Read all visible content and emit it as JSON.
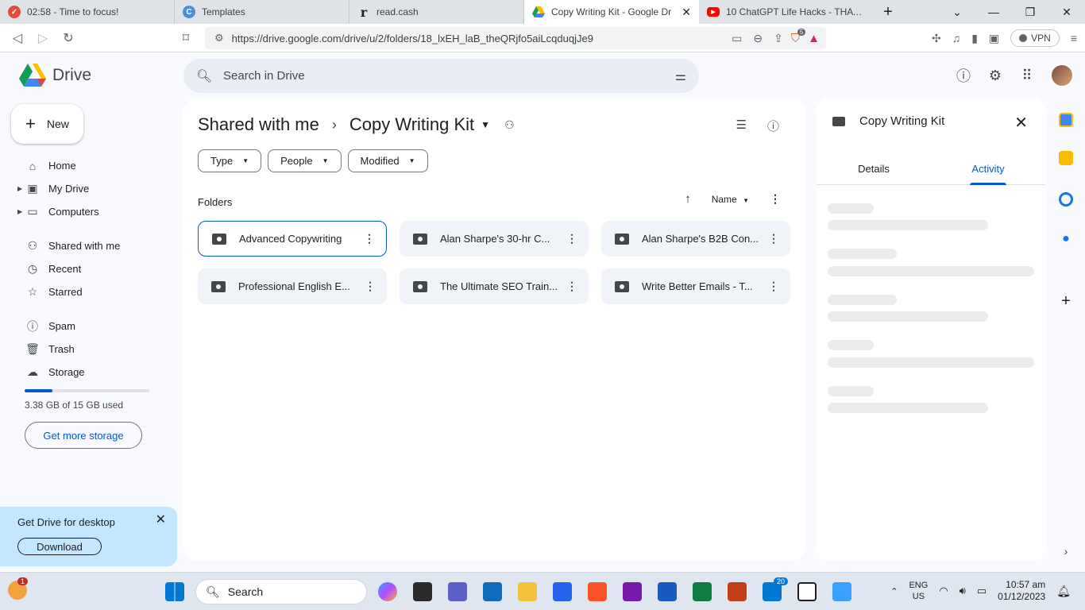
{
  "browser": {
    "tabs": [
      {
        "label": "02:58 - Time to focus!",
        "color": "#e34c3c",
        "icon": "focus-timer-icon"
      },
      {
        "label": "Templates",
        "color": "#4a90d9",
        "icon": "canva-icon"
      },
      {
        "label": "read.cash",
        "color": "#202124",
        "icon": "readcash-icon"
      },
      {
        "label": "Copy Writing Kit - Google Dr",
        "color": "#fbbc04",
        "icon": "drive-icon"
      },
      {
        "label": "10 ChatGPT Life Hacks - THAT'LL C",
        "color": "#ff0000",
        "icon": "youtube-icon"
      }
    ],
    "url": "https://drive.google.com/drive/u/2/folders/18_lxEH_laB_theQRjfo5aiLcqduqjJe9",
    "vpn_label": "VPN",
    "brave_badge": "5"
  },
  "drive": {
    "app_name": "Drive",
    "search_placeholder": "Search in Drive",
    "new_label": "New",
    "nav": {
      "home": "Home",
      "my_drive": "My Drive",
      "computers": "Computers",
      "shared": "Shared with me",
      "recent": "Recent",
      "starred": "Starred",
      "spam": "Spam",
      "trash": "Trash",
      "storage": "Storage"
    },
    "storage_used_fraction": 0.225,
    "storage_text": "3.38 GB of 15 GB used",
    "get_storage_label": "Get more storage",
    "promo": {
      "title": "Get Drive for desktop",
      "button": "Download"
    },
    "breadcrumb": {
      "parent": "Shared with me",
      "current": "Copy Writing Kit"
    },
    "filters": [
      "Type",
      "People",
      "Modified"
    ],
    "section_label": "Folders",
    "sort_label": "Name",
    "folders": [
      "Advanced Copywriting",
      "Alan Sharpe's 30-hr C...",
      "Alan Sharpe's B2B Con...",
      "Professional English E...",
      "The Ultimate SEO Train...",
      "Write Better Emails - T..."
    ],
    "details": {
      "title": "Copy Writing Kit",
      "tab_details": "Details",
      "tab_activity": "Activity"
    }
  },
  "taskbar": {
    "search_label": "Search",
    "lang_line1": "ENG",
    "lang_line2": "US",
    "time": "10:57 am",
    "date": "01/12/2023",
    "notif_badge": "1",
    "store_badge": "20"
  }
}
